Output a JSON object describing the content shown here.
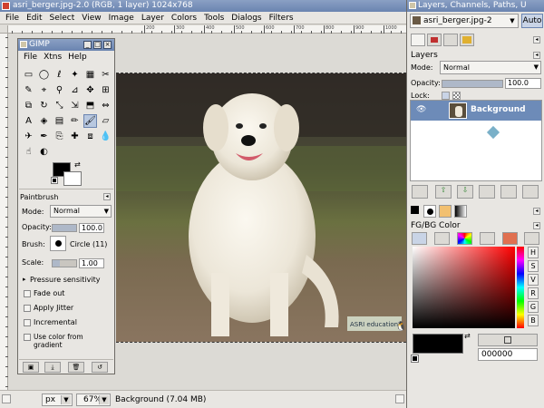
{
  "main_window": {
    "title": "asri_berger.jpg-2.0 (RGB, 1 layer) 1024x768",
    "menu": [
      "File",
      "Edit",
      "Select",
      "View",
      "Image",
      "Layer",
      "Colors",
      "Tools",
      "Dialogs",
      "Filters"
    ],
    "ruler_labels": [
      "200",
      "300",
      "400",
      "500",
      "600",
      "700",
      "800",
      "900",
      "1000"
    ],
    "watermark": "ASRI education",
    "status": {
      "unit": "px",
      "zoom": "67%",
      "info": "Background (7.04 MB)"
    }
  },
  "toolbox": {
    "title": "GIMP",
    "menu": [
      "File",
      "Xtns",
      "Help"
    ],
    "tool_options_title": "Paintbrush",
    "mode_label": "Mode:",
    "mode_value": "Normal",
    "opacity_label": "Opacity:",
    "opacity_value": "100.0",
    "brush_label": "Brush:",
    "brush_value": "Circle (11)",
    "scale_label": "Scale:",
    "scale_value": "1.00",
    "pressure_label": "Pressure sensitivity",
    "options": [
      "Fade out",
      "Apply Jitter",
      "Incremental",
      "Use color from gradient"
    ]
  },
  "dock": {
    "title": "Layers, Channels, Paths, U",
    "image_select": "asri_berger.jpg-2",
    "auto_label": "Auto",
    "layers_title": "Layers",
    "mode_label": "Mode:",
    "mode_value": "Normal",
    "opacity_label": "Opacity:",
    "opacity_value": "100.0",
    "lock_label": "Lock:",
    "layer_name": "Background",
    "color_title": "FG/BG Color",
    "hsv_buttons": [
      "H",
      "S",
      "V",
      "R",
      "G",
      "B"
    ],
    "hex_value": "000000"
  },
  "colors": {
    "titlebar": "#6a84b0",
    "layer_selected": "#6d8bb8",
    "foreground": "#000000",
    "background": "#ffffff"
  }
}
